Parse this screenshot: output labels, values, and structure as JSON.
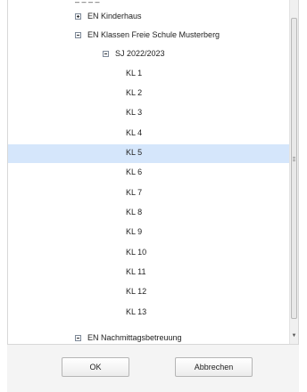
{
  "tree": {
    "top_cut_text": "– – – –",
    "nodes": [
      {
        "label": "EN Kinderhaus",
        "state": "collapsed"
      },
      {
        "label": "EN Klassen Freie Schule Musterberg",
        "state": "expanded"
      },
      {
        "label": "SJ 2022/2023",
        "state": "expanded"
      },
      {
        "label": "KL 1"
      },
      {
        "label": "KL 2"
      },
      {
        "label": "KL 3"
      },
      {
        "label": "KL 4"
      },
      {
        "label": "KL 5",
        "selected": true
      },
      {
        "label": "KL 6"
      },
      {
        "label": "KL 7"
      },
      {
        "label": "KL 8"
      },
      {
        "label": "KL 9"
      },
      {
        "label": "KL 10"
      },
      {
        "label": "KL 11"
      },
      {
        "label": "KL 12"
      },
      {
        "label": "KL 13"
      },
      {
        "label": "EN Nachmittagsbetreuung",
        "state": "expanded"
      }
    ]
  },
  "buttons": {
    "ok_label": "OK",
    "cancel_label": "Abbrechen"
  },
  "colors": {
    "selection": "#d5e6fb",
    "footer": "#f4f4f4"
  }
}
